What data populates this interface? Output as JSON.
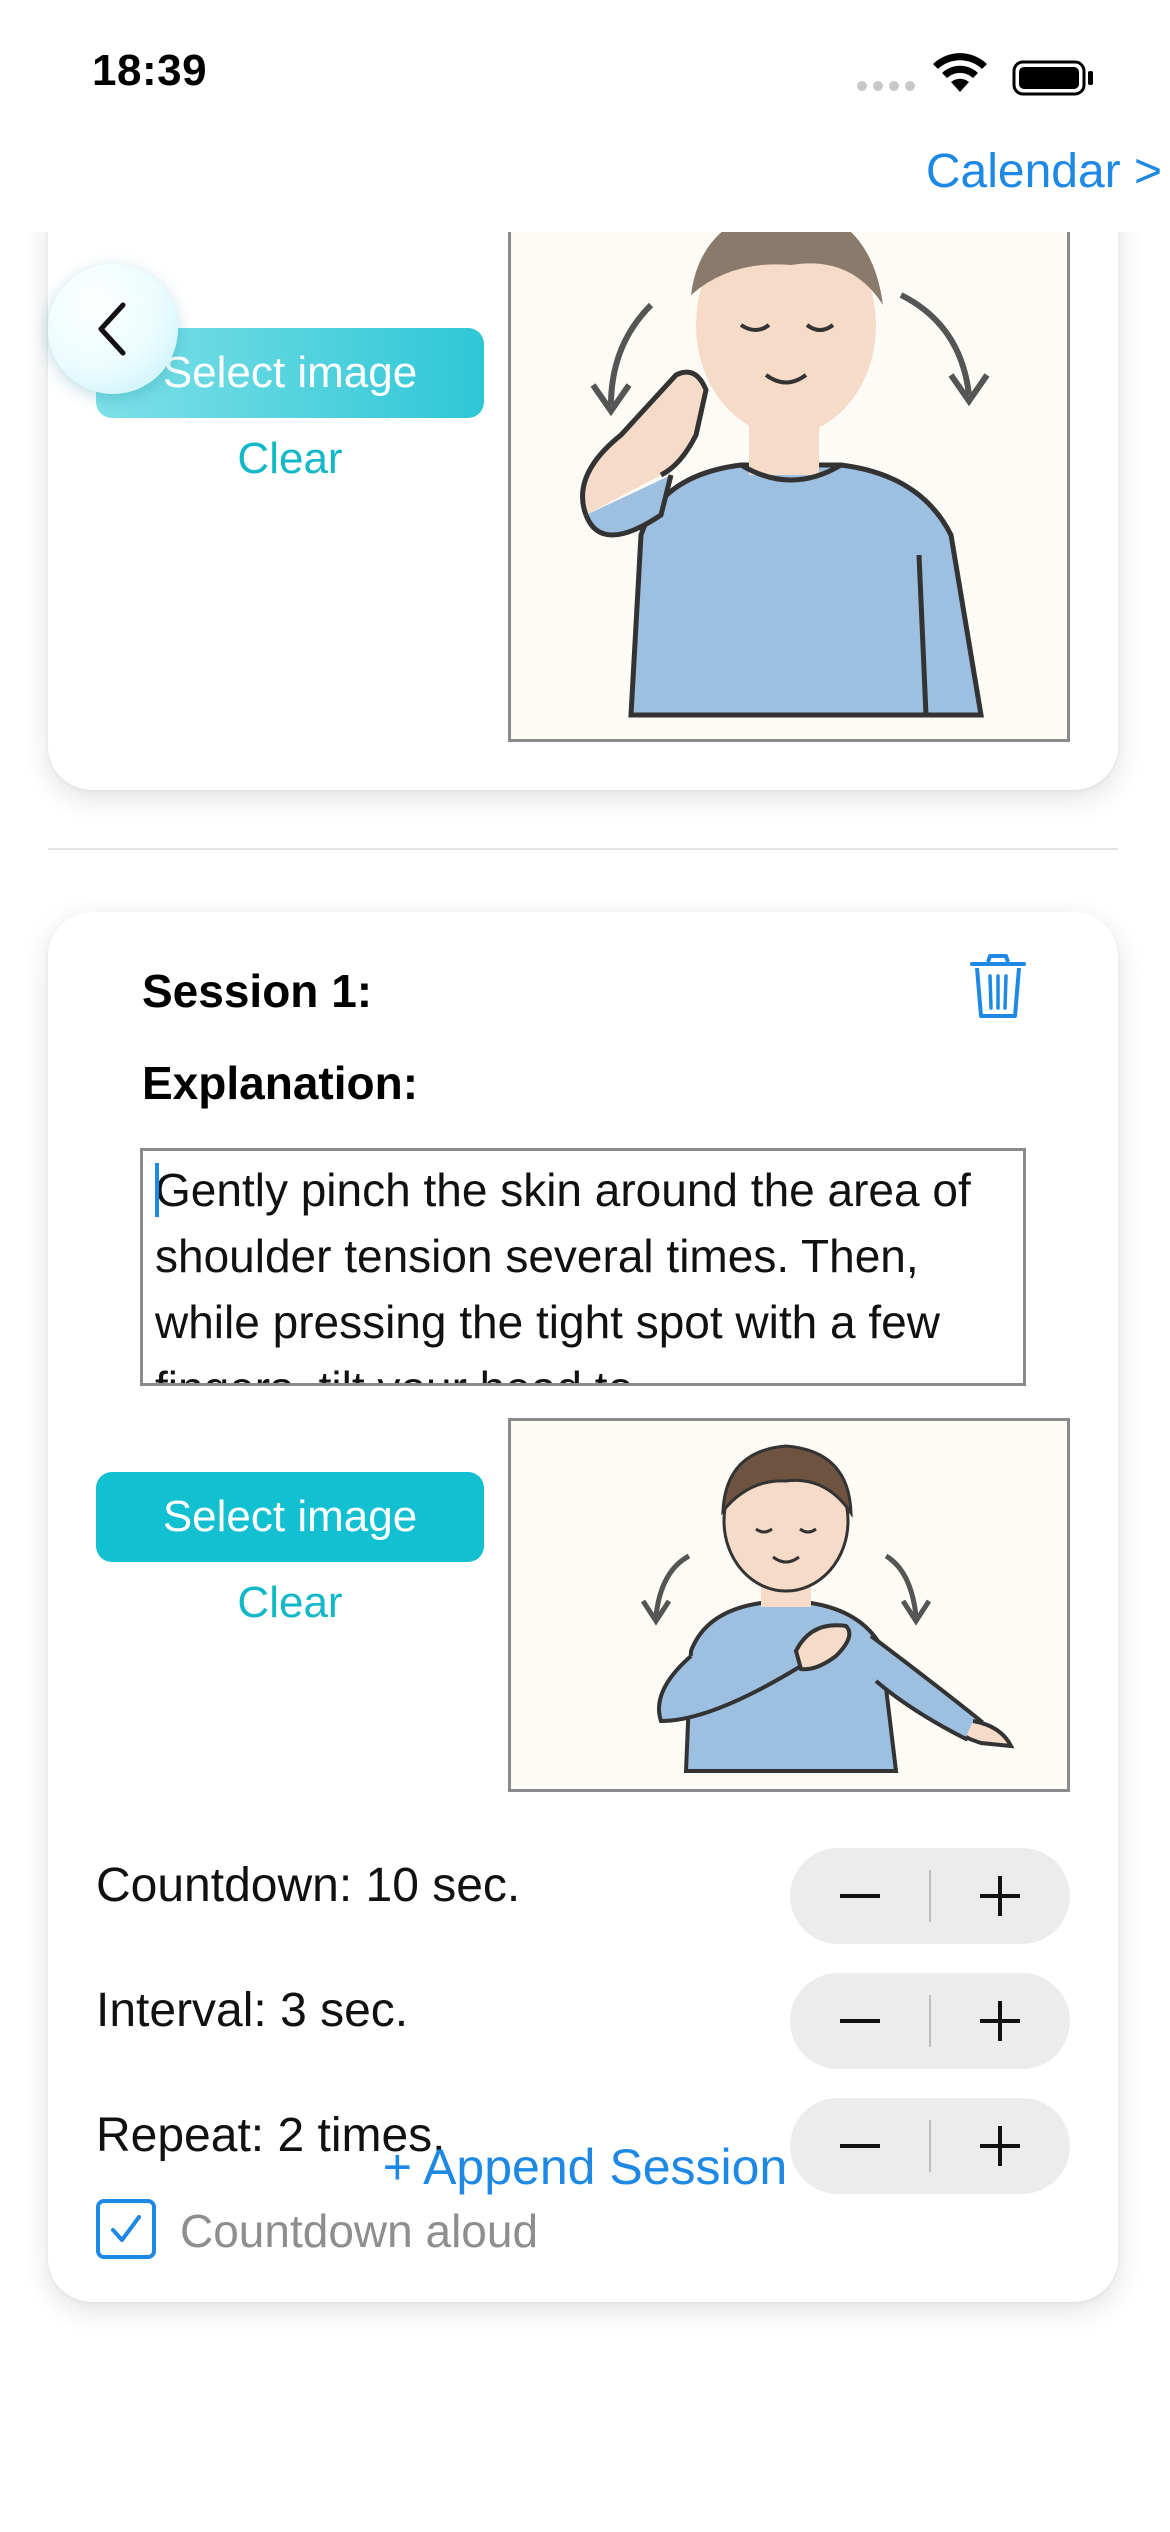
{
  "status_bar": {
    "time": "18:39"
  },
  "nav": {
    "calendar_link": "Calendar >"
  },
  "top_card": {
    "select_image_label": "Select image",
    "clear_label": "Clear"
  },
  "session": {
    "title": "Session 1:",
    "explanation_label": "Explanation:",
    "explanation_text": "Gently pinch the skin around the area of shoulder tension several times. Then, while pressing the tight spot with a few fingers, tilt your head to",
    "select_image_label": "Select image",
    "clear_label": "Clear",
    "countdown_label": "Countdown: 10 sec.",
    "interval_label": "Interval: 3 sec.",
    "repeat_label": "Repeat: 2 times.",
    "countdown_aloud_label": "Countdown aloud",
    "countdown_aloud_checked": true
  },
  "append_session_label": "+ Append Session",
  "colors": {
    "accent_blue": "#1e88e5",
    "accent_teal": "#12c0d1",
    "shirt_blue": "#9dbfe0"
  }
}
